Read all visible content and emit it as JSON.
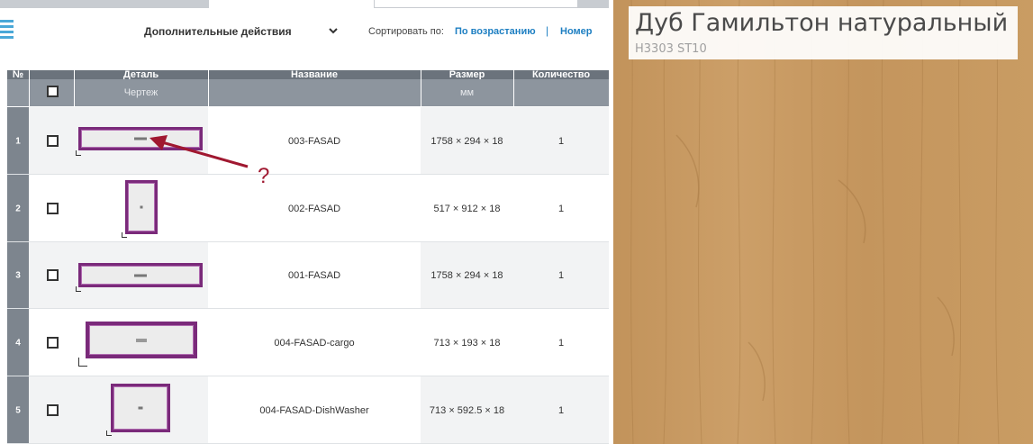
{
  "toolbar": {
    "actions_label": "Дополнительные действия",
    "sort_label": "Сортировать по:",
    "sort_order": "По возрастанию",
    "sort_separator": "|",
    "sort_field": "Номер"
  },
  "table": {
    "headers": {
      "num": "№",
      "part": "Деталь",
      "name": "Название",
      "size": "Размер",
      "qty": "Количество"
    },
    "subheaders": {
      "part": "Чертеж",
      "size": "мм"
    },
    "rows": [
      {
        "num": "1",
        "name": "003-FASAD",
        "size": "1758 × 294 × 18",
        "qty": "1"
      },
      {
        "num": "2",
        "name": "002-FASAD",
        "size": "517 × 912 × 18",
        "qty": "1"
      },
      {
        "num": "3",
        "name": "001-FASAD",
        "size": "1758 × 294 × 18",
        "qty": "1"
      },
      {
        "num": "4",
        "name": "004-FASAD-cargo",
        "size": "713 × 193 × 18",
        "qty": "1"
      },
      {
        "num": "5",
        "name": "004-FASAD-DishWasher",
        "size": "713 × 592.5 × 18",
        "qty": "1"
      }
    ]
  },
  "annotation": {
    "mark": "?",
    "color": "#a01830"
  },
  "material": {
    "name": "Дуб Гамильтон натуральный",
    "code": "H3303 ST10",
    "wood_color": "#c89a62"
  },
  "colors": {
    "accent": "#1e7fc2",
    "part_border": "#7a2a7a",
    "header_dark": "#6b737c",
    "header_light": "#8d959e"
  }
}
